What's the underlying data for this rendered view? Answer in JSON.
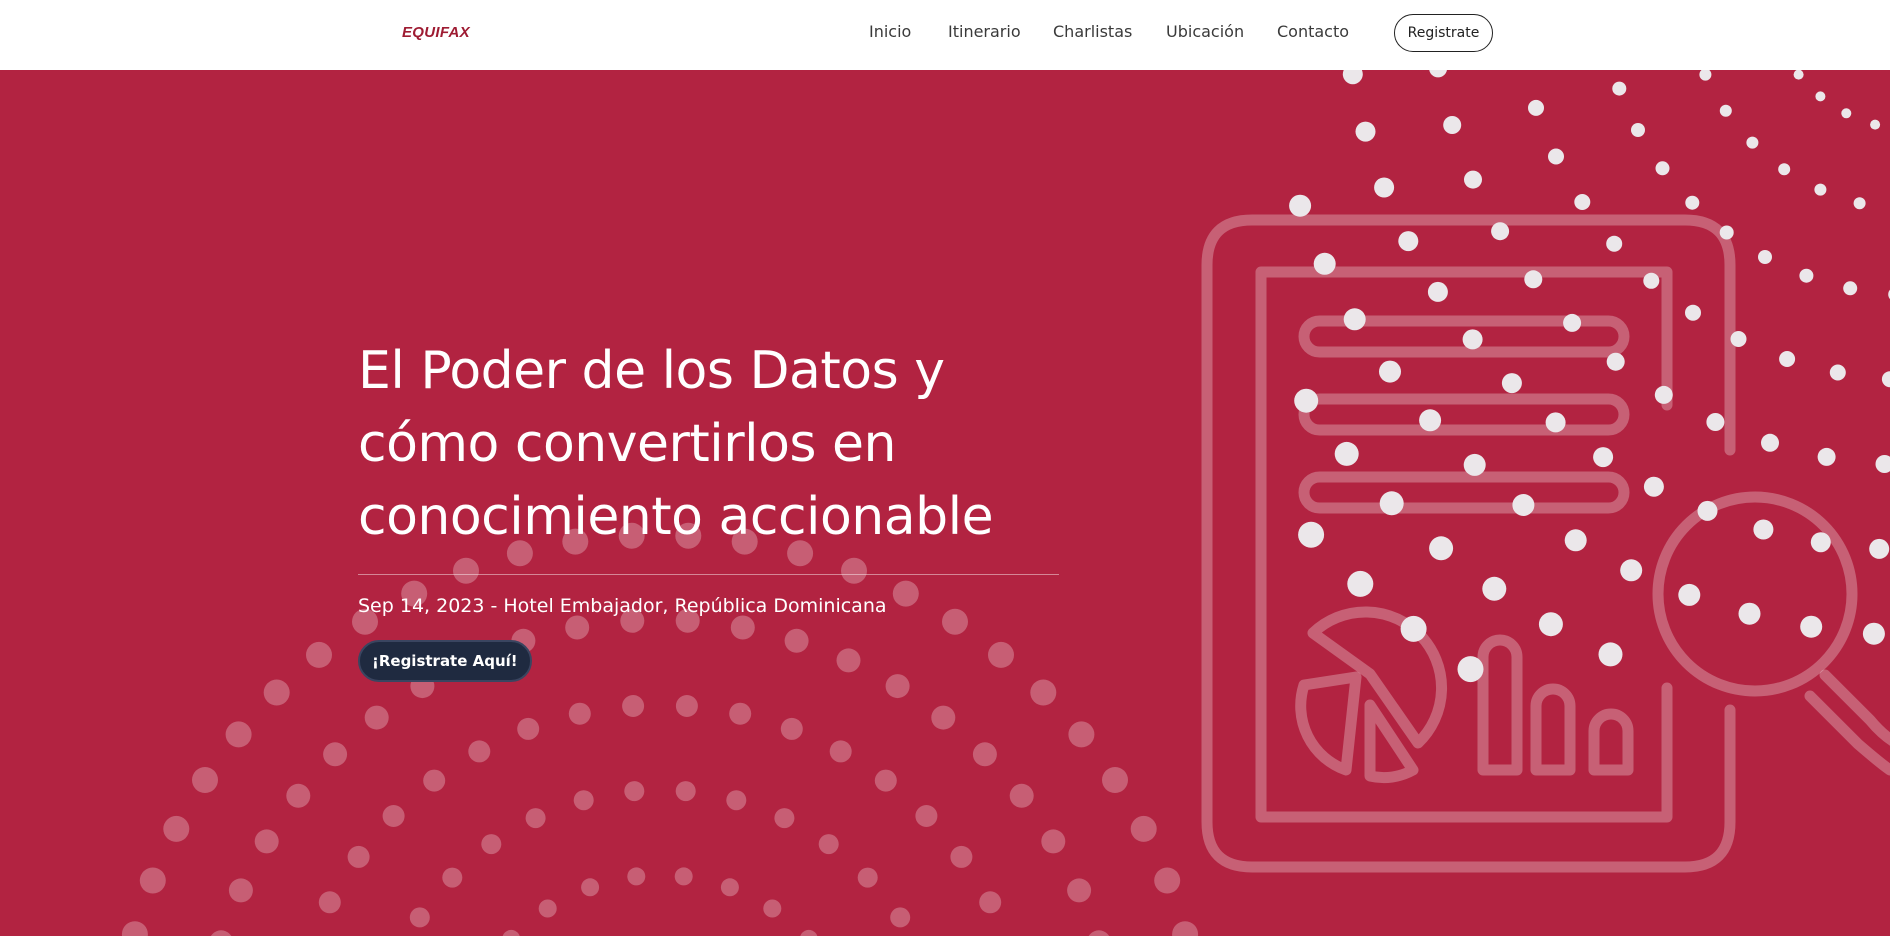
{
  "brand": {
    "logo_text": "EQUIFAX",
    "accent_color": "#b22341",
    "logo_color": "#9e1b32"
  },
  "nav": {
    "links": [
      "Inicio",
      "Itinerario",
      "Charlistas",
      "Ubicación",
      "Contacto"
    ],
    "cta_label": "Registrate"
  },
  "hero": {
    "title_lines": [
      "El Poder de los Datos y",
      "cómo convertirlos en",
      "conocimiento accionable"
    ],
    "event_info": "Sep 14, 2023 - Hotel Embajador, República Dominicana",
    "cta_label": "¡Registrate Aquí!",
    "cta_color": "#1f2a40",
    "illustration_icons": [
      "document-icon",
      "pie-chart-icon",
      "bar-chart-icon",
      "magnifier-icon"
    ]
  }
}
